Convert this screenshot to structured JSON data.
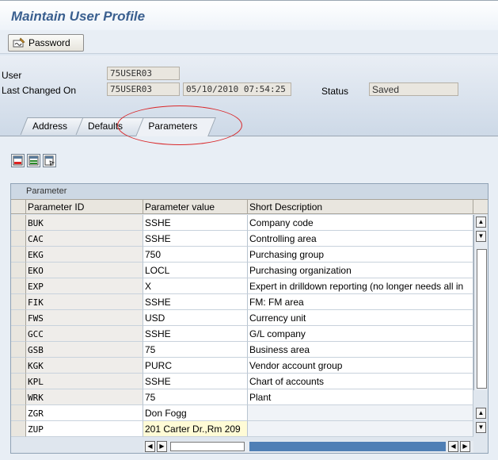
{
  "window": {
    "title": "Maintain User Profile"
  },
  "toolbar": {
    "password_label": "Password"
  },
  "header": {
    "user_label": "User",
    "user_value": "75USER03",
    "last_changed_label": "Last Changed On",
    "last_changed_user": "75USER03",
    "last_changed_date": "05/10/2010",
    "last_changed_time": "07:54:25",
    "status_label": "Status",
    "status_value": "Saved"
  },
  "tabs": [
    {
      "label": "Address"
    },
    {
      "label": "Defaults"
    },
    {
      "label": "Parameters",
      "active": true
    }
  ],
  "table": {
    "caption": "Parameter",
    "columns": [
      "Parameter ID",
      "Parameter value",
      "Short Description"
    ],
    "rows": [
      {
        "id": "BUK",
        "value": "SSHE",
        "desc": "Company code"
      },
      {
        "id": "CAC",
        "value": "SSHE",
        "desc": "Controlling area"
      },
      {
        "id": "EKG",
        "value": "750",
        "desc": "Purchasing group"
      },
      {
        "id": "EKO",
        "value": "LOCL",
        "desc": "Purchasing organization"
      },
      {
        "id": "EXP",
        "value": "X",
        "desc": "Expert in drilldown reporting (no longer needs all in"
      },
      {
        "id": "FIK",
        "value": "SSHE",
        "desc": "FM: FM area"
      },
      {
        "id": "FWS",
        "value": "USD",
        "desc": "Currency unit"
      },
      {
        "id": "GCC",
        "value": "SSHE",
        "desc": "G/L company"
      },
      {
        "id": "GSB",
        "value": "75",
        "desc": "Business area"
      },
      {
        "id": "KGK",
        "value": "PURC",
        "desc": "Vendor account group"
      },
      {
        "id": "KPL",
        "value": "SSHE",
        "desc": "Chart of accounts"
      },
      {
        "id": "WRK",
        "value": "75",
        "desc": "Plant"
      },
      {
        "id": "ZGR",
        "value": "Don Fogg",
        "desc": ""
      },
      {
        "id": "ZUP",
        "value": "201 Carter Dr.,Rm 209",
        "desc": ""
      }
    ]
  },
  "colors": {
    "title": "#3a5f8f",
    "highlight_circle": "#d9282a",
    "field_highlight": "#fffbd6"
  }
}
